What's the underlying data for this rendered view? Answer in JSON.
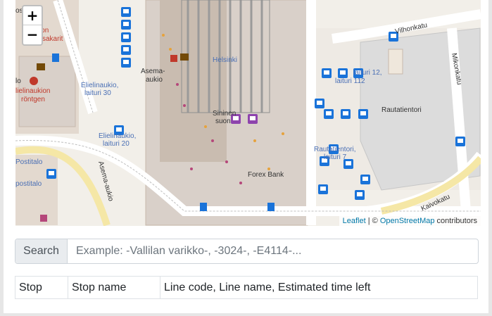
{
  "map": {
    "zoom_in": "+",
    "zoom_out": "−",
    "labels": {
      "helsinki": "Helsinki",
      "asema_aukio_1": "Asema-",
      "asema_aukio_2": "aukio",
      "elielinaukio_30_1": "Elielinaukio,",
      "elielinaukio_30_2": "laituri 30",
      "elielinaukio_20_1": "Elielinaukio,",
      "elielinaukio_20_2": "laituri 20",
      "rautatientori": "Rautatientori",
      "rautatientori_7_1": "Rautatientori,",
      "rautatientori_7_2": "laituri 7",
      "forex": "Forex Bank",
      "sininen_1": "Sininen",
      "sininen_2": "suon",
      "kaivokatu": "Kaivokatu",
      "mikonkatu": "Mikonkatu",
      "vilhonkatu": "Vilhonkatu",
      "asema_aukio_road": "Asema-aukio",
      "postitalo_1": "Postitalo",
      "postitalo_2": "postitalo",
      "lielinaukion": "lielinaukion",
      "rontgen": "röntgen",
      "postion": "Postion",
      "sakarit": "sakarit",
      "lo": "lo",
      "osta": "osta",
      "laituri_112": "laituri 112",
      "laituri_12": "laituri 12,"
    },
    "attribution": {
      "leaflet": "Leaflet",
      "sep": " | © ",
      "osm": "OpenStreetMap",
      "contrib": " contributors"
    }
  },
  "search": {
    "label": "Search",
    "placeholder": "Example: -Vallilan varikko-, -3024-, -E4114-..."
  },
  "table": {
    "headers": [
      "Stop",
      "Stop name",
      "Line code, Line name, Estimated time left"
    ]
  },
  "colors": {
    "bus_stop": "#1a73d9",
    "tram_stop": "#1a73d9",
    "metro_stop": "#8e44ad",
    "map_bg": "#f2efe9",
    "building": "#d9d0c9",
    "road": "#ffffff"
  }
}
